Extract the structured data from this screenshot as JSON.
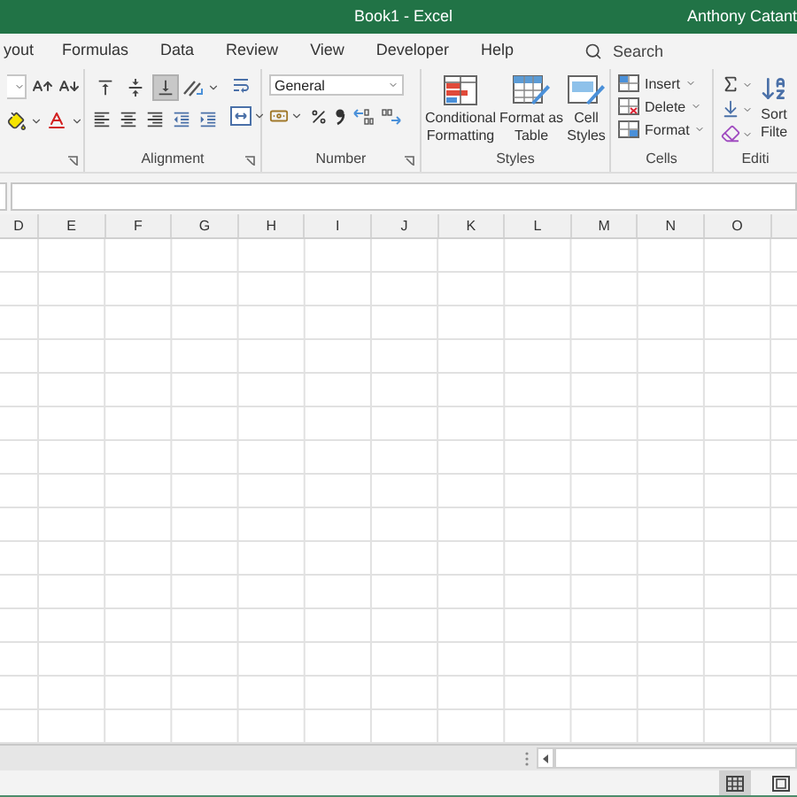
{
  "title_bar": {
    "title": "Book1  -  Excel",
    "user": "Anthony Catant"
  },
  "tabs": [
    {
      "label": "yout",
      "selected": false
    },
    {
      "label": "Formulas",
      "selected": false
    },
    {
      "label": "Data",
      "selected": false
    },
    {
      "label": "Review",
      "selected": false
    },
    {
      "label": "View",
      "selected": false
    },
    {
      "label": "Developer",
      "selected": false
    },
    {
      "label": "Help",
      "selected": false
    }
  ],
  "search": {
    "placeholder": "Search"
  },
  "ribbon": {
    "alignment": {
      "label": "Alignment",
      "vertical": [
        {
          "kind": "top",
          "selected": false
        },
        {
          "kind": "middle",
          "selected": false
        },
        {
          "kind": "bottom",
          "selected": true
        }
      ]
    },
    "number": {
      "label": "Number",
      "format": "General"
    },
    "styles": {
      "label": "Styles",
      "buttons": [
        {
          "kind": "conditional",
          "lines": [
            "Conditional",
            "Formatting"
          ]
        },
        {
          "kind": "table",
          "lines": [
            "Format as",
            "Table"
          ]
        },
        {
          "kind": "cell",
          "lines": [
            "Cell",
            "Styles"
          ]
        }
      ]
    },
    "cells": {
      "label": "Cells",
      "buttons": [
        {
          "kind": "insert",
          "label": "Insert"
        },
        {
          "kind": "delete",
          "label": "Delete"
        },
        {
          "kind": "format",
          "label": "Format"
        }
      ]
    },
    "editing": {
      "label": "Editi",
      "sort_lines": [
        "Sort",
        "Filte"
      ]
    }
  },
  "columns": [
    "D",
    "E",
    "F",
    "G",
    "H",
    "I",
    "J",
    "K",
    "L",
    "M",
    "N",
    "O"
  ],
  "status_bar": {
    "views": [
      {
        "kind": "normal",
        "selected": true
      },
      {
        "kind": "page_layout",
        "selected": false
      }
    ]
  }
}
